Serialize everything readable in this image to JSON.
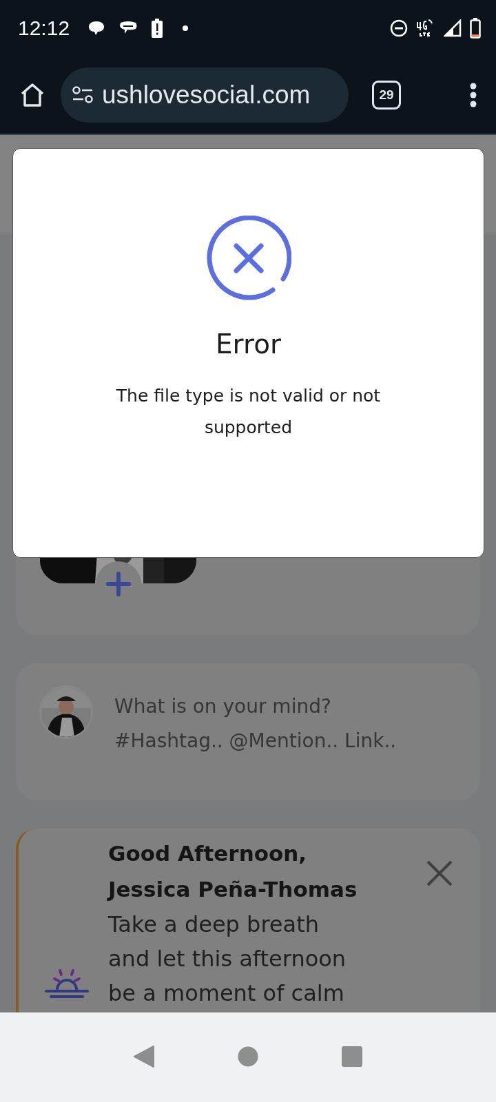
{
  "status_bar": {
    "time": "12:12"
  },
  "browser": {
    "url": "ushlovesocial.com",
    "tab_count": "29"
  },
  "dialog": {
    "title": "Error",
    "message": "The file type is not valid or not supported"
  },
  "composer": {
    "placeholder": "What is on your mind?\n#Hashtag.. @Mention.. Link.."
  },
  "greeting": {
    "salutation": "Good Afternoon,",
    "name": "Jessica Peña-Thomas",
    "message": "Take a deep breath and let this afternoon be a moment of calm"
  }
}
